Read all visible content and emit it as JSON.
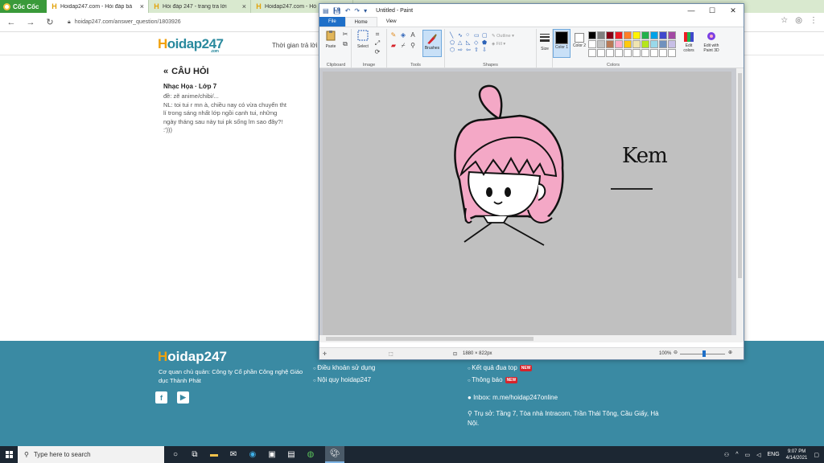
{
  "browser": {
    "brand": "Cốc Cốc",
    "tabs": [
      {
        "title": "Hoidap247.com - Hỏi đáp bà",
        "active": true
      },
      {
        "title": "Hỏi đáp 247 - trang tra lời",
        "active": false
      },
      {
        "title": "Hoidap247.com - Hỏ",
        "active": false
      }
    ],
    "url": "hoidap247.com/answer_question/1803926"
  },
  "site": {
    "logo": "oidap247",
    "logo_h": "H",
    "logo_com": ".com",
    "header_time": "Thời gian trả lời",
    "question": {
      "heading": "CÂU HỎI",
      "subject": "Nhạc Họa · Lớp 7",
      "lines": [
        "đề: zẽ anime/chibi/...",
        "NL: toi tui r mn à, chiều nay có vừa chuyển tht",
        "lí trong sáng nhất lớp ngồi cạnh tui, những",
        "ngày tháng sau này tui pk sống lm sao đây?!",
        ":')))"
      ]
    },
    "footer": {
      "company": "Cơ quan chủ quản: Công ty Cổ phần Công nghệ Giáo dục Thành Phát",
      "links_col1": [
        "Điều khoản sử dụng",
        "Nội quy hoidap247"
      ],
      "links_col2": [
        "Kết quả đua top",
        "Thông báo"
      ],
      "new_badge": "NEW",
      "inbox": "Inbox: m.me/hoidap247online",
      "address": "Trụ sở: Tầng 7, Tòa nhà Intracom, Trần Thái Tông, Cầu Giấy, Hà Nội."
    }
  },
  "paint": {
    "title": "Untitled - Paint",
    "tabs": [
      "File",
      "Home",
      "View"
    ],
    "groups": {
      "clipboard": "Clipboard",
      "image": "Image",
      "tools": "Tools",
      "shapes": "Shapes",
      "colors": "Colors"
    },
    "buttons": {
      "paste": "Paste",
      "select": "Select",
      "brushes": "Brushes",
      "outline": "Outline",
      "fill": "Fill",
      "size": "Size",
      "color1": "Color 1",
      "color2": "Color 2",
      "edit_colors": "Edit colors",
      "edit_paint3d": "Edit with Paint 3D"
    },
    "color1": "#000000",
    "color2": "#ffffff",
    "palette": [
      "#000000",
      "#7f7f7f",
      "#880015",
      "#ed1c24",
      "#ff7f27",
      "#fff200",
      "#22b14c",
      "#00a2e8",
      "#3f48cc",
      "#a349a4",
      "#ffffff",
      "#c3c3c3",
      "#b97a57",
      "#ffaec9",
      "#ffc90e",
      "#efe4b0",
      "#b5e61d",
      "#99d9ea",
      "#7092be",
      "#c8bfe7",
      "#ffffff",
      "#ffffff",
      "#ffffff",
      "#ffffff",
      "#ffffff",
      "#ffffff",
      "#ffffff",
      "#ffffff",
      "#ffffff",
      "#ffffff"
    ],
    "canvas_text": "Kem",
    "status_size": "1880 × 822px",
    "zoom": "100%"
  },
  "taskbar": {
    "search_placeholder": "Type here to search",
    "lang": "ENG",
    "time": "9:07 PM",
    "date": "4/14/2021"
  }
}
